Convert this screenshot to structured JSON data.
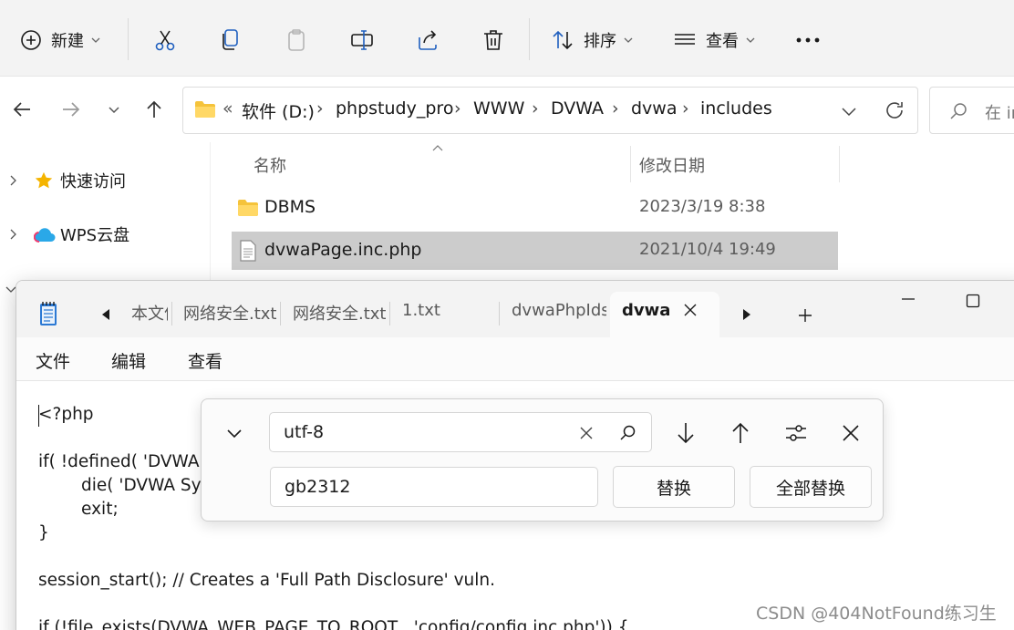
{
  "explorer": {
    "toolbar": {
      "new_label": "新建",
      "sort_label": "排序",
      "view_label": "查看"
    },
    "address": {
      "overflow": "«",
      "crumbs": [
        "软件 (D:)",
        "phpstudy_pro",
        "WWW",
        "DVWA",
        "dvwa",
        "includes"
      ]
    },
    "search": {
      "placeholder": "在 in"
    },
    "sidebar": {
      "items": [
        {
          "label": "快速访问"
        },
        {
          "label": "WPS云盘"
        }
      ]
    },
    "columns": {
      "name": "名称",
      "modified": "修改日期"
    },
    "files": [
      {
        "name": "DBMS",
        "date": "2023/3/19 8:38",
        "type": "folder"
      },
      {
        "name": "dvwaPage.inc.php",
        "date": "2021/10/4 19:49",
        "type": "file",
        "selected": true
      }
    ]
  },
  "notepad": {
    "tabs": [
      "本文件",
      "网络安全.txt",
      "网络安全.txt",
      "1.txt",
      "dvwaPhpIds.",
      "dvwa"
    ],
    "active_tab": "dvwa",
    "menu": {
      "file": "文件",
      "edit": "编辑",
      "view": "查看"
    },
    "code": [
      "<?php",
      "",
      "if( !defined( 'DVWA",
      "        die( 'DVWA Sy",
      "        exit;",
      "}",
      "",
      "session_start(); // Creates a 'Full Path Disclosure' vuln.",
      "",
      "if (!file_exists(DVWA_WEB_PAGE_TO_ROOT . 'config/config.inc.php')) {"
    ],
    "find": {
      "find_value": "utf-8",
      "replace_value": "gb2312",
      "replace_label": "替换",
      "replace_all_label": "全部替换"
    }
  },
  "watermark": "CSDN @404NotFound练习生"
}
